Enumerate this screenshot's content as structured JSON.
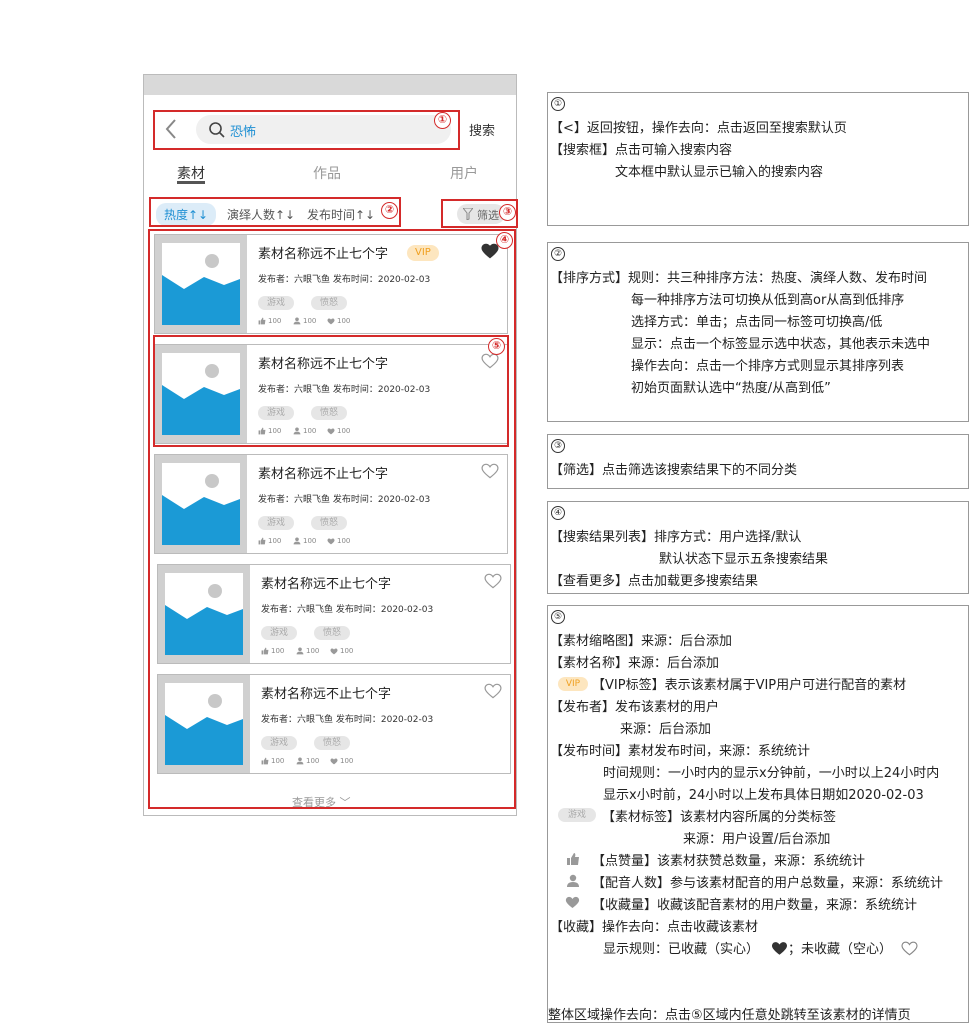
{
  "phone": {
    "back_label": "〈",
    "search_text": "恐怖",
    "search_button": "搜索",
    "tabs": [
      "素材",
      "作品",
      "用户"
    ],
    "sort": [
      "热度↑↓",
      "演绎人数↑↓",
      "发布时间↑↓"
    ],
    "filter_label": "筛选",
    "cards": [
      {
        "title": "素材名称远不止七个字",
        "vip": "VIP",
        "favorited": true,
        "publisher": "发布者：六眼飞鱼    发布时间：2020-02-03",
        "tags": [
          "游戏",
          "愤怒"
        ],
        "likes": "100",
        "voices": "100",
        "favs": "100"
      },
      {
        "title": "素材名称远不止七个字",
        "vip": "",
        "favorited": false,
        "publisher": "发布者：六眼飞鱼    发布时间：2020-02-03",
        "tags": [
          "游戏",
          "愤怒"
        ],
        "likes": "100",
        "voices": "100",
        "favs": "100"
      },
      {
        "title": "素材名称远不止七个字",
        "vip": "",
        "favorited": false,
        "publisher": "发布者：六眼飞鱼    发布时间：2020-02-03",
        "tags": [
          "游戏",
          "愤怒"
        ],
        "likes": "100",
        "voices": "100",
        "favs": "100"
      },
      {
        "title": "素材名称远不止七个字",
        "vip": "",
        "favorited": false,
        "publisher": "发布者：六眼飞鱼    发布时间：2020-02-03",
        "tags": [
          "游戏",
          "愤怒"
        ],
        "likes": "100",
        "voices": "100",
        "favs": "100"
      },
      {
        "title": "素材名称远不止七个字",
        "vip": "",
        "favorited": false,
        "publisher": "发布者：六眼飞鱼    发布时间：2020-02-03",
        "tags": [
          "游戏",
          "愤怒"
        ],
        "likes": "100",
        "voices": "100",
        "favs": "100"
      }
    ],
    "see_more": "查看更多 ﹀"
  },
  "markers": [
    "①",
    "②",
    "③",
    "④",
    "⑤"
  ],
  "panels": {
    "p1": {
      "num": "①",
      "lines": [
        "【<】返回按钮，操作去向：点击返回至搜索默认页",
        "【搜索框】点击可输入搜索内容",
        "文本框中默认显示已输入的搜索内容"
      ]
    },
    "p2": {
      "num": "②",
      "lines": [
        "【排序方式】规则：共三种排序方法：热度、演绎人数、发布时间",
        "每一种排序方法可切换从低到高or从高到低排序",
        "选择方式：单击；点击同一标签可切换高/低",
        "显示：点击一个标签显示选中状态，其他表示未选中",
        "操作去向：点击一个排序方式则显示其排序列表",
        "初始页面默认选中“热度/从高到低”"
      ]
    },
    "p3": {
      "num": "③",
      "lines": [
        "【筛选】点击筛选该搜索结果下的不同分类"
      ]
    },
    "p4": {
      "num": "④",
      "lines": [
        "【搜索结果列表】排序方式：用户选择/默认",
        "默认状态下显示五条搜索结果",
        "【查看更多】点击加载更多搜索结果"
      ]
    },
    "p5": {
      "num": "⑤",
      "vip_label": "VIP",
      "tag_label": "游戏",
      "lines": [
        "【素材缩略图】来源：后台添加",
        "【素材名称】来源：后台添加",
        "【VIP标签】表示该素材属于VIP用户可进行配音的素材",
        "【发布者】发布该素材的用户",
        "来源：后台添加",
        "【发布时间】素材发布时间，来源：系统统计",
        "时间规则：一小时内的显示x分钟前，一小时以上24小时内",
        "显示x小时前，24小时以上发布具体日期如2020-02-03",
        "【素材标签】该素材内容所属的分类标签",
        "来源：用户设置/后台添加",
        "【点赞量】该素材获赞总数量，来源：系统统计",
        "【配音人数】参与该素材配音的用户总数量，来源：系统统计",
        "【收藏量】收藏该配音素材的用户数量，来源：系统统计",
        "【收藏】操作去向：点击收藏该素材",
        "显示规则：已收藏（实心）",
        "；未收藏（空心）",
        "整体区域操作去向：点击⑤区域内任意处跳转至该素材的详情页"
      ]
    }
  },
  "colors": {
    "accent": "#1e8fd3",
    "annotation_red": "#d42a2a",
    "vip_bg": "#fde6bf",
    "vip_text": "#f0a020"
  }
}
